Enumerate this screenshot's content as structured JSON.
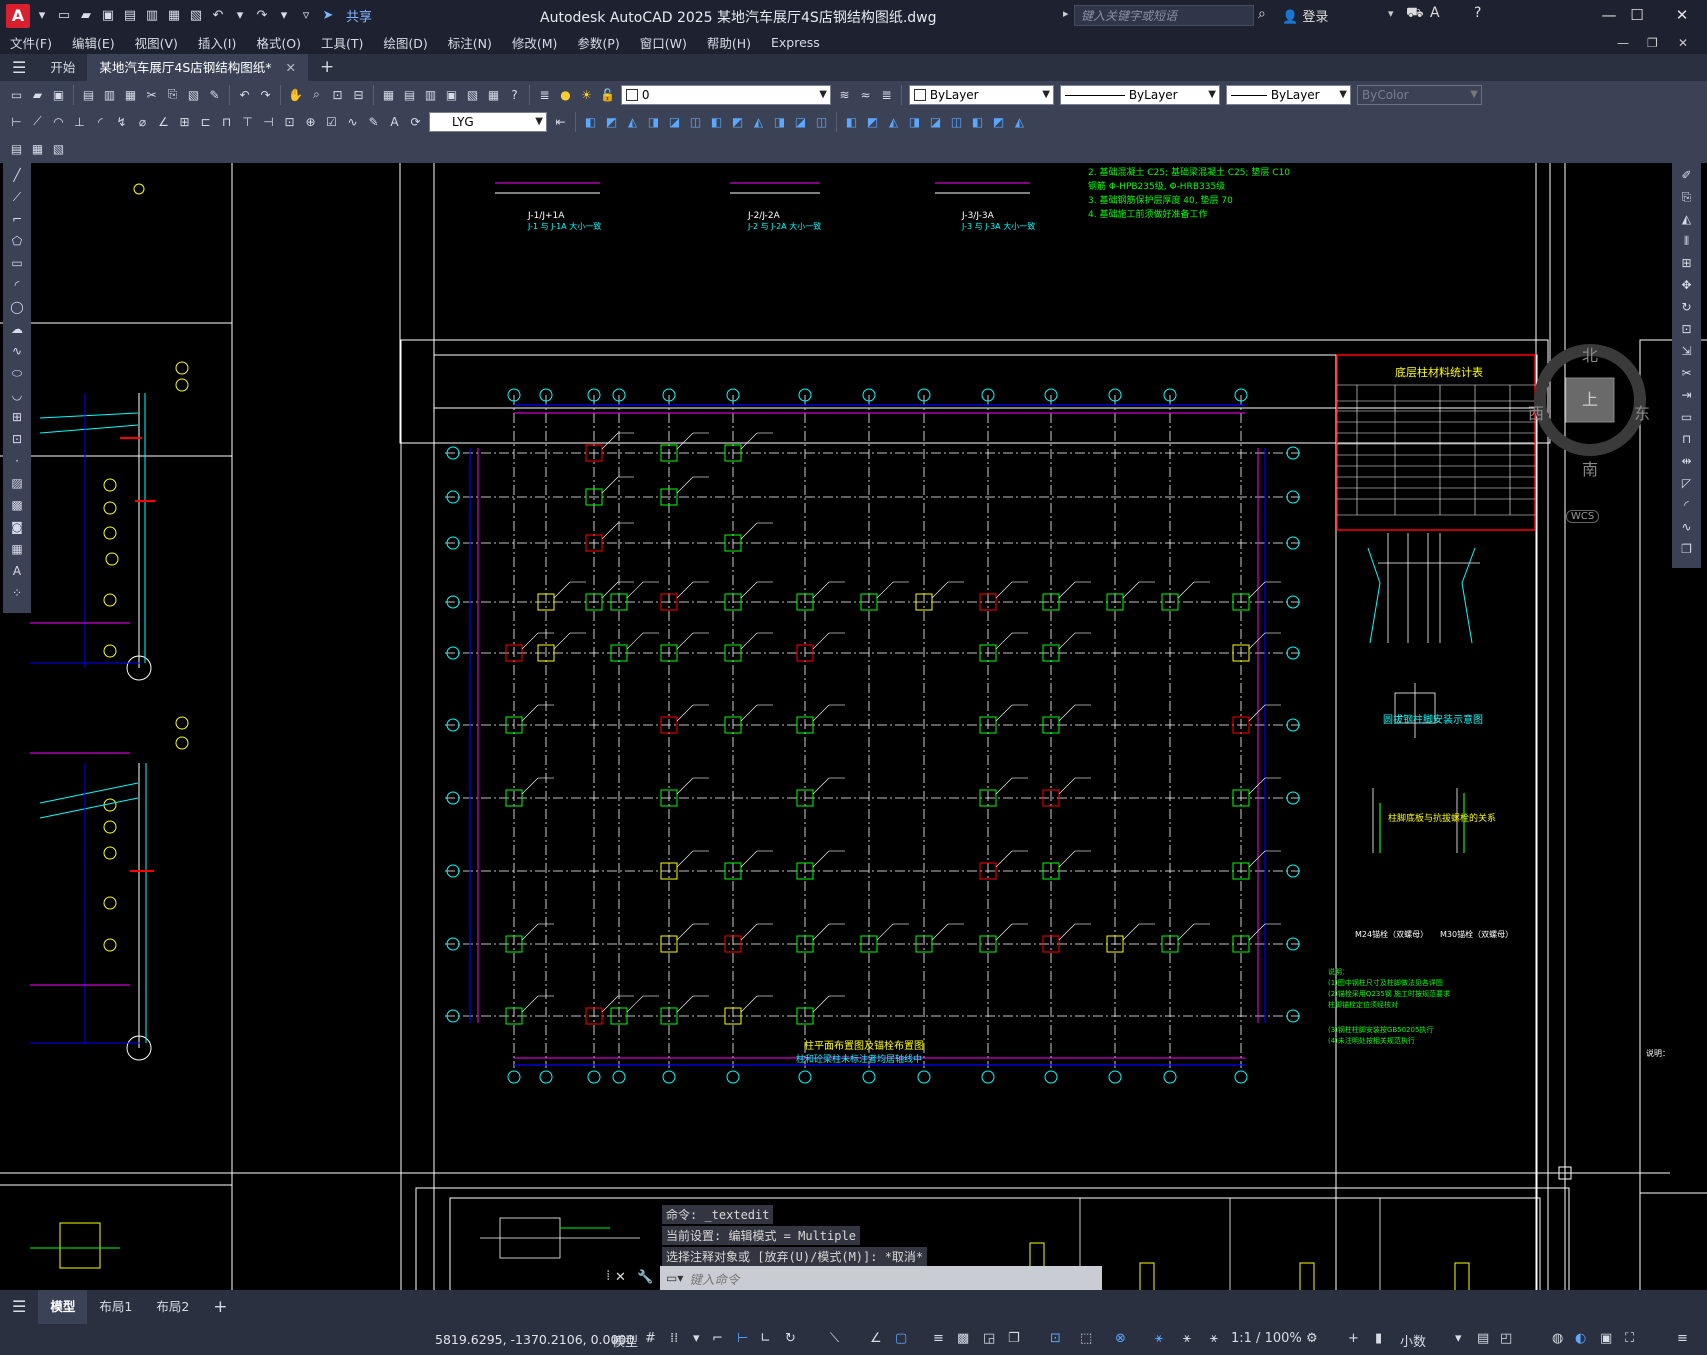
{
  "titlebar": {
    "logo": "A",
    "share": "共享",
    "app_title": "Autodesk AutoCAD 2025    某地汽车展厅4S店钢结构图纸.dwg",
    "search_placeholder": "键入关键字或短语",
    "login": "登录"
  },
  "menu": [
    "文件(F)",
    "编辑(E)",
    "视图(V)",
    "插入(I)",
    "格式(O)",
    "工具(T)",
    "绘图(D)",
    "标注(N)",
    "修改(M)",
    "参数(P)",
    "窗口(W)",
    "帮助(H)",
    "Express"
  ],
  "tabs": {
    "start": "开始",
    "document": "某地汽车展厅4S店钢结构图纸*"
  },
  "toolbar": {
    "layer_value": "0",
    "color_value": "ByLayer",
    "linetype_value": "ByLayer",
    "lineweight_value": "ByLayer",
    "plotstyle_value": "ByColor",
    "textstyle_value": "LYG"
  },
  "viewcube": {
    "north": "北",
    "south": "南",
    "east": "东",
    "west": "西",
    "top": "上",
    "wcs": "WCS"
  },
  "drawing": {
    "table_title": "底层柱材料统计表",
    "plan_title": "柱平面布置图及锚栓布置图",
    "plan_subtitle": "柱和砼梁柱未标注者均居轴线中",
    "install_title": "圆拔钢柱脚安装示意图",
    "anchor_title": "柱脚底板与抗拔螺栓的关系",
    "m24": "M24锚栓（双螺母）",
    "m30": "M30锚栓（双螺母）",
    "notes_head": "说明："
  },
  "command": {
    "history": [
      "命令: _textedit",
      "当前设置: 编辑模式 = Multiple",
      "选择注释对象或 [放弃(U)/模式(M)]: *取消*"
    ],
    "placeholder": "键入命令"
  },
  "layouts": [
    "模型",
    "布局1",
    "布局2"
  ],
  "status": {
    "coords": "5819.6295, -1370.2106, 0.0000",
    "model": "模型",
    "scale": "1:1 / 100%",
    "units": "小数"
  }
}
